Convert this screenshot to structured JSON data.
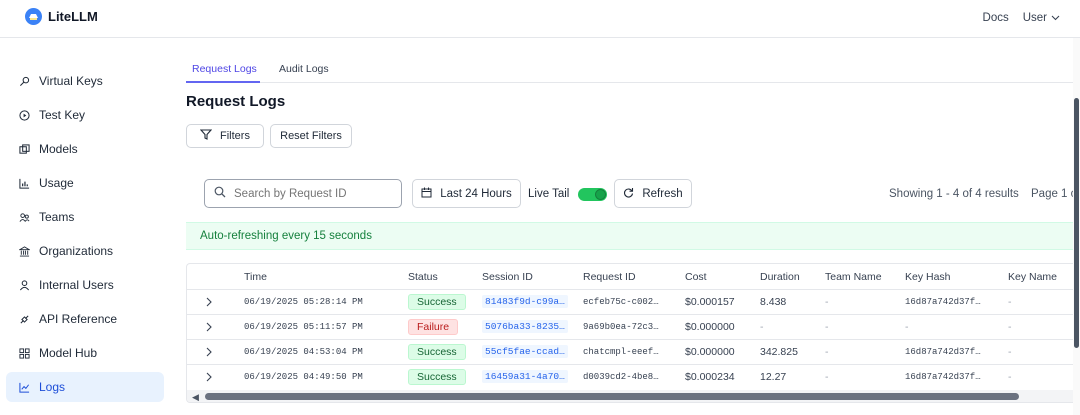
{
  "app": {
    "name": "LiteLLM"
  },
  "topnav": {
    "docs": "Docs",
    "user": "User"
  },
  "sidebar": {
    "items": [
      {
        "label": "Virtual Keys",
        "icon": "key-icon"
      },
      {
        "label": "Test Key",
        "icon": "play-circle-icon"
      },
      {
        "label": "Models",
        "icon": "block-icon"
      },
      {
        "label": "Usage",
        "icon": "bar-chart-icon"
      },
      {
        "label": "Teams",
        "icon": "team-icon"
      },
      {
        "label": "Organizations",
        "icon": "bank-icon"
      },
      {
        "label": "Internal Users",
        "icon": "user-icon"
      },
      {
        "label": "API Reference",
        "icon": "api-icon"
      },
      {
        "label": "Model Hub",
        "icon": "apps-icon"
      },
      {
        "label": "Logs",
        "icon": "line-chart-icon",
        "active": true
      }
    ]
  },
  "tabs": [
    {
      "label": "Request Logs",
      "active": true
    },
    {
      "label": "Audit Logs"
    }
  ],
  "page_title": "Request Logs",
  "filters": {
    "filters_label": "Filters",
    "reset_label": "Reset Filters"
  },
  "toolbar": {
    "search_placeholder": "Search by Request ID",
    "time_range": "Last 24 Hours",
    "live_tail_label": "Live Tail",
    "live_tail_on": true,
    "refresh_label": "Refresh",
    "results_text": "Showing 1 - 4 of 4 results",
    "page_text": "Page 1 c"
  },
  "banner": "Auto-refreshing every 15 seconds",
  "colors": {
    "accent": "#6366f1",
    "success": "#166534",
    "failure": "#b91c1c",
    "link": "#2563eb"
  },
  "table": {
    "columns": [
      "Time",
      "Status",
      "Session ID",
      "Request ID",
      "Cost",
      "Duration",
      "Team Name",
      "Key Hash",
      "Key Name"
    ],
    "rows": [
      {
        "time": "06/19/2025 05:28:14 PM",
        "status": "Success",
        "session_id": "81483f9d-c99a…",
        "request_id": "ecfeb75c-c002…",
        "cost": "$0.000157",
        "duration": "8.438",
        "team": "-",
        "key_hash": "16d87a742d37f…",
        "key_name": "-"
      },
      {
        "time": "06/19/2025 05:11:57 PM",
        "status": "Failure",
        "session_id": "5076ba33-8235…",
        "request_id": "9a69b0ea-72c3…",
        "cost": "$0.000000",
        "duration": "-",
        "team": "-",
        "key_hash": "-",
        "key_name": "-"
      },
      {
        "time": "06/19/2025 04:53:04 PM",
        "status": "Success",
        "session_id": "55cf5fae-ccad…",
        "request_id": "chatcmpl-eeef…",
        "cost": "$0.000000",
        "duration": "342.825",
        "team": "-",
        "key_hash": "16d87a742d37f…",
        "key_name": "-"
      },
      {
        "time": "06/19/2025 04:49:50 PM",
        "status": "Success",
        "session_id": "16459a31-4a70…",
        "request_id": "d0039cd2-4be8…",
        "cost": "$0.000234",
        "duration": "12.27",
        "team": "-",
        "key_hash": "16d87a742d37f…",
        "key_name": "-"
      }
    ]
  }
}
